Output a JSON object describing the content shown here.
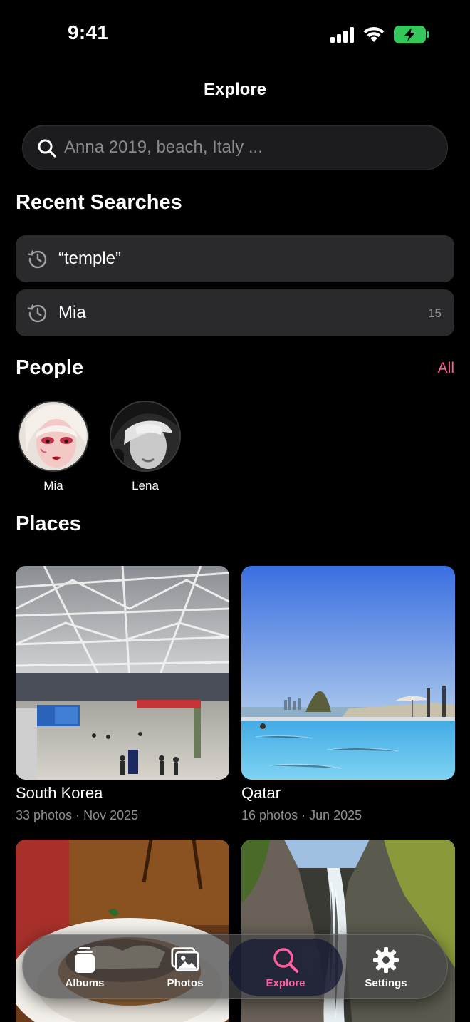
{
  "status_bar": {
    "time": "9:41"
  },
  "header": {
    "title": "Explore"
  },
  "search": {
    "placeholder": "Anna 2019, beach, Italy ..."
  },
  "recent_searches": {
    "heading": "Recent Searches",
    "items": [
      {
        "label": "“temple”",
        "count": ""
      },
      {
        "label": "Mia",
        "count": "15"
      }
    ]
  },
  "people": {
    "heading": "People",
    "all_label": "All",
    "items": [
      {
        "name": "Mia"
      },
      {
        "name": "Lena"
      }
    ]
  },
  "places": {
    "heading": "Places",
    "items": [
      {
        "name": "South Korea",
        "meta": "33 photos · Nov 2025"
      },
      {
        "name": "Qatar",
        "meta": "16 photos · Jun 2025"
      },
      {
        "name": "",
        "meta": ""
      },
      {
        "name": "",
        "meta": ""
      }
    ]
  },
  "tab_bar": {
    "accent_color": "#ff5fa0",
    "tabs": [
      {
        "label": "Albums",
        "icon": "albums-icon"
      },
      {
        "label": "Photos",
        "icon": "photos-icon"
      },
      {
        "label": "Explore",
        "icon": "search-icon",
        "active": true
      },
      {
        "label": "Settings",
        "icon": "gear-icon"
      }
    ]
  }
}
